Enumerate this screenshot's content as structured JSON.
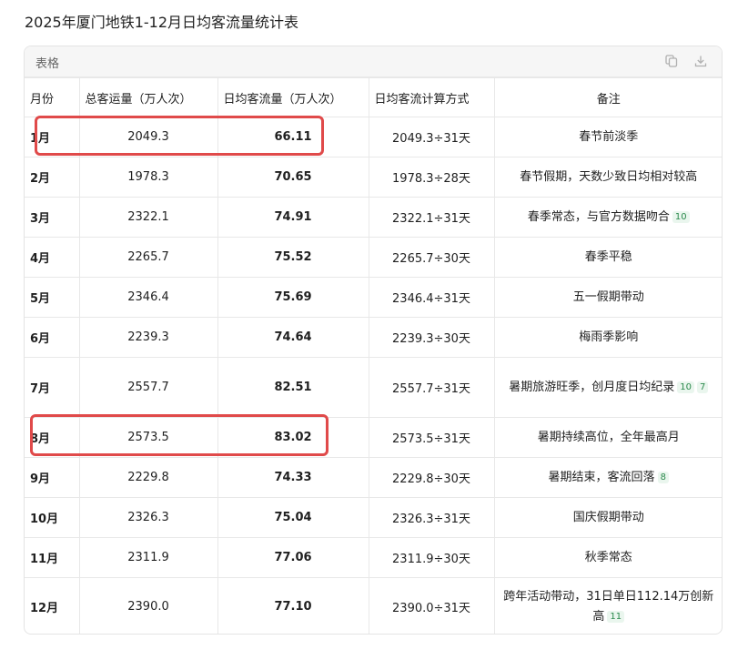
{
  "title": "2025年厦门地铁1-12月日均客流量统计表",
  "card": {
    "label": "表格",
    "icons": [
      "copy-icon",
      "download-icon"
    ]
  },
  "table": {
    "headers": [
      "月份",
      "总客运量（万人次）",
      "日均客流量（万人次）",
      "日均客流计算方式",
      "备注"
    ],
    "rows": [
      {
        "month": "1月",
        "total": "2049.3",
        "daily": "66.11",
        "calc": "2049.3÷31天",
        "note": "春节前淡季",
        "cites": []
      },
      {
        "month": "2月",
        "total": "1978.3",
        "daily": "70.65",
        "calc": "1978.3÷28天",
        "note": "春节假期，天数少致日均相对较高",
        "cites": []
      },
      {
        "month": "3月",
        "total": "2322.1",
        "daily": "74.91",
        "calc": "2322.1÷31天",
        "note": "春季常态，与官方数据吻合",
        "cites": [
          "10"
        ]
      },
      {
        "month": "4月",
        "total": "2265.7",
        "daily": "75.52",
        "calc": "2265.7÷30天",
        "note": "春季平稳",
        "cites": []
      },
      {
        "month": "5月",
        "total": "2346.4",
        "daily": "75.69",
        "calc": "2346.4÷31天",
        "note": "五一假期带动",
        "cites": []
      },
      {
        "month": "6月",
        "total": "2239.3",
        "daily": "74.64",
        "calc": "2239.3÷30天",
        "note": "梅雨季影响",
        "cites": []
      },
      {
        "month": "7月",
        "total": "2557.7",
        "daily": "82.51",
        "calc": "2557.7÷31天",
        "note": "暑期旅游旺季，创月度日均纪录",
        "cites": [
          "10",
          "7"
        ]
      },
      {
        "month": "8月",
        "total": "2573.5",
        "daily": "83.02",
        "calc": "2573.5÷31天",
        "note": "暑期持续高位，全年最高月",
        "cites": []
      },
      {
        "month": "9月",
        "total": "2229.8",
        "daily": "74.33",
        "calc": "2229.8÷30天",
        "note": "暑期结束，客流回落",
        "cites": [
          "8"
        ]
      },
      {
        "month": "10月",
        "total": "2326.3",
        "daily": "75.04",
        "calc": "2326.3÷31天",
        "note": "国庆假期带动",
        "cites": []
      },
      {
        "month": "11月",
        "total": "2311.9",
        "daily": "77.06",
        "calc": "2311.9÷30天",
        "note": "秋季常态",
        "cites": []
      },
      {
        "month": "12月",
        "total": "2390.0",
        "daily": "77.10",
        "calc": "2390.0÷31天",
        "note": "跨年活动带动，31日单日112.14万创新高",
        "cites": [
          "11"
        ]
      }
    ]
  },
  "highlight_color": "#e04a4a"
}
